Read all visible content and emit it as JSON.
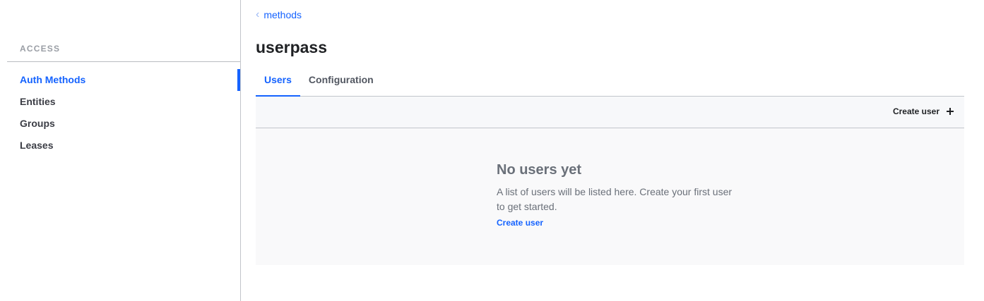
{
  "sidebar": {
    "heading": "ACCESS",
    "items": [
      {
        "label": "Auth Methods",
        "active": true
      },
      {
        "label": "Entities",
        "active": false
      },
      {
        "label": "Groups",
        "active": false
      },
      {
        "label": "Leases",
        "active": false
      }
    ]
  },
  "breadcrumb": {
    "label": "methods",
    "icon": "chevron-left-icon"
  },
  "page": {
    "title": "userpass"
  },
  "tabs": [
    {
      "label": "Users",
      "active": true
    },
    {
      "label": "Configuration",
      "active": false
    }
  ],
  "toolbar": {
    "create_label": "Create user",
    "icon": "plus-icon"
  },
  "empty_state": {
    "title": "No users yet",
    "message": "A list of users will be listed here. Create your first user to get started.",
    "link_label": "Create user"
  },
  "colors": {
    "accent": "#1563ff",
    "muted_text": "#6a7079",
    "border": "#c2c5cb"
  }
}
